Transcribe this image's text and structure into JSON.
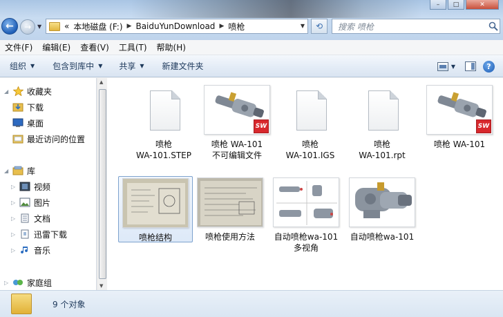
{
  "address": {
    "segments": [
      "本地磁盘 (F:)",
      "BaiduYunDownload",
      "喷枪"
    ],
    "overflow": "«"
  },
  "search": {
    "placeholder": "搜索 喷枪"
  },
  "menu": [
    "文件(F)",
    "编辑(E)",
    "查看(V)",
    "工具(T)",
    "帮助(H)"
  ],
  "commands": {
    "organize": "组织",
    "include_library": "包含到库中",
    "share": "共享",
    "new_folder": "新建文件夹"
  },
  "nav": {
    "favorites": "收藏夹",
    "downloads": "下载",
    "desktop": "桌面",
    "recent": "最近访问的位置",
    "libraries": "库",
    "videos": "视频",
    "pictures": "图片",
    "documents": "文档",
    "thunder": "迅雷下载",
    "music": "音乐",
    "homegroup": "家庭组"
  },
  "files": [
    {
      "name": "喷枪\nWA-101.STEP",
      "type": "doc"
    },
    {
      "name": "喷枪 WA-101\n不可编辑文件",
      "type": "sw"
    },
    {
      "name": "喷枪\nWA-101.IGS",
      "type": "doc"
    },
    {
      "name": "喷枪\nWA-101.rpt",
      "type": "doc"
    },
    {
      "name": "喷枪 WA-101",
      "type": "sw"
    },
    {
      "name": "喷枪结构",
      "type": "photo"
    },
    {
      "name": "喷枪使用方法",
      "type": "photo"
    },
    {
      "name": "自动喷枪wa-101\n多视角",
      "type": "multiview"
    },
    {
      "name": "自动喷枪wa-101",
      "type": "render"
    }
  ],
  "status": {
    "count": "9 个对象"
  },
  "colors": {
    "accent": "#1e395b",
    "sw_red": "#d8282d"
  }
}
